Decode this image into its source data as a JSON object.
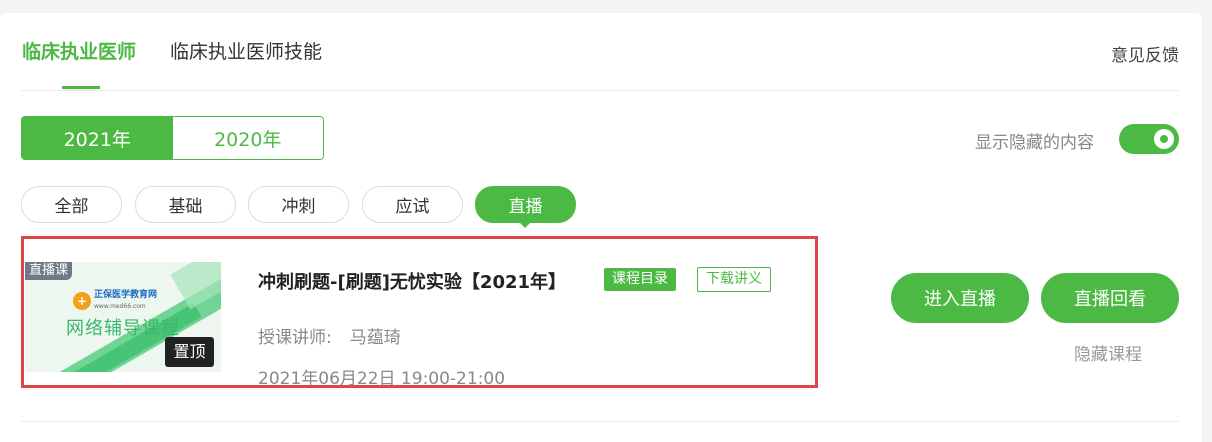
{
  "tabs": [
    {
      "label": "临床执业医师",
      "active": true
    },
    {
      "label": "临床执业医师技能",
      "active": false
    }
  ],
  "feedback_label": "意见反馈",
  "years": [
    {
      "label": "2021年",
      "active": true
    },
    {
      "label": "2020年",
      "active": false
    }
  ],
  "toggle": {
    "label": "显示隐藏的内容",
    "on": true
  },
  "filters": [
    {
      "label": "全部",
      "active": false
    },
    {
      "label": "基础",
      "active": false
    },
    {
      "label": "冲刺",
      "active": false
    },
    {
      "label": "应试",
      "active": false
    },
    {
      "label": "直播",
      "active": true
    }
  ],
  "course": {
    "thumbnail": {
      "badge": "直播课",
      "pin": "置顶",
      "logo_name": "正保医学教育网",
      "logo_url": "www.med66.com",
      "title": "网络辅导课程"
    },
    "title": "冲刺刷题-[刷题]无忧实验【2021年】",
    "tag_catalog": "课程目录",
    "tag_download": "下载讲义",
    "lecturer_label": "授课讲师:",
    "lecturer_name": "马蕴琦",
    "datetime": "2021年06月22日 19:00-21:00",
    "actions": {
      "enter_live": "进入直播",
      "replay": "直播回看",
      "hide": "隐藏课程"
    }
  },
  "colors": {
    "accent": "#4cb944",
    "highlight_border": "#e0444b"
  }
}
